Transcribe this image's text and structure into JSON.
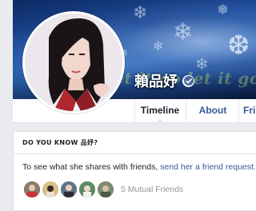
{
  "profile": {
    "name": "賴品妤",
    "verified": true
  },
  "cover": {
    "overlay_text": "let it go let it go"
  },
  "nav": {
    "tabs": [
      {
        "label": "Timeline",
        "active": true
      },
      {
        "label": "About",
        "active": false
      },
      {
        "label": "Fri",
        "active": false
      }
    ]
  },
  "know_card": {
    "header": "DO YOU KNOW 品妤?",
    "prompt_text": "To see what she shares with friends, ",
    "link_text": "send her a friend request.",
    "mutual_friends": "5 Mutual Friends",
    "friend_avatar_count": 5
  },
  "colors": {
    "link": "#365899",
    "page_bg": "#e9ebee",
    "verified_badge": "#4e69a2"
  }
}
